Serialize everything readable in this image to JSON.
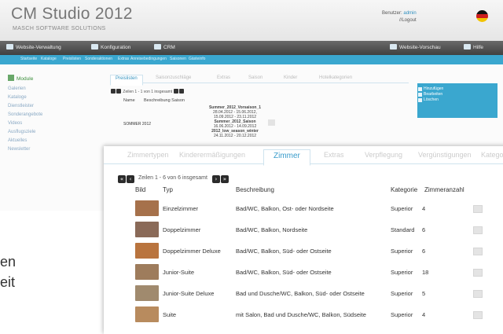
{
  "app": {
    "title": "CM Studio 2012",
    "subtitle": "MASCH SOFTWARE SOLUTIONS",
    "user_label": "Benutzer:",
    "user_name": "admin",
    "logout": "//Logout",
    "flag_colors": [
      "#111111",
      "#cc1e1e",
      "#f2c300"
    ]
  },
  "nav": {
    "items": [
      "Website-Verwaltung",
      "Konfiguration",
      "CRM",
      "Website-Vorschau",
      "Hilfe"
    ]
  },
  "subnav": {
    "items": [
      "Startseite",
      "Kataloge",
      "Preislisten",
      "Sonderaktionen",
      "Extras",
      "Anreisebedingungen",
      "Saisonen",
      "Gästeinfo"
    ]
  },
  "sidebar": {
    "heading": "Module",
    "items": [
      "Galerien",
      "Kataloge",
      "Dienstleister",
      "Sonderangebote",
      "Videos",
      "Ausflugsziele",
      "Aktuelles",
      "Newsletter"
    ]
  },
  "main": {
    "tabs": [
      "Preislisten",
      "Saisonzuschläge",
      "Extras",
      "Saison",
      "Kinder",
      "Hotelkategorien"
    ],
    "pager_text": "Zeilen 1 - 1 von 1 insgesamt",
    "col_name": "Name",
    "col_desc": "Beschreibung Saison",
    "row_name": "SOMMER 2012",
    "seasons": [
      {
        "name": "Summer_2012_Vorsaison_1",
        "dates": "28.04.2012 - 15.06.2012,"
      },
      {
        "name": "",
        "dates": "15.09.2012 - 23.11.2012"
      },
      {
        "name": "Summer_2012_Saison",
        "dates": "16.06.2012 - 14.09.2012"
      },
      {
        "name": "2012_low_season_winter",
        "dates": "24.11.2012 - 20.12.2012"
      }
    ]
  },
  "right_panel": {
    "items": [
      "Hinzufügen",
      "Bearbeiten",
      "Löschen"
    ]
  },
  "background_text": [
    "en",
    "eit"
  ],
  "fg": {
    "tabs": [
      "Zimmertypen",
      "Kinderermäßigungen",
      "Zimmer",
      "Extras",
      "Verpflegung",
      "Vergünstigungen",
      "Kategorien"
    ],
    "pager": {
      "prev_first": "«",
      "prev": "‹",
      "text": "Zeilen 1 - 6 von 6 insgesamt",
      "next": "›",
      "last": "»"
    },
    "columns": {
      "bild": "Bild",
      "typ": "Typ",
      "desc": "Beschreibung",
      "kat": "Kategorie",
      "anz": "Zimmeranzahl"
    },
    "rows": [
      {
        "typ": "Einzelzimmer",
        "desc": "Bad/WC, Balkon, Ost- oder Nordseite",
        "kat": "Superior",
        "anz": "4",
        "thumb_color": "#a6714b"
      },
      {
        "typ": "Doppelzimmer",
        "desc": "Bad/WC, Balkon, Nordseite",
        "kat": "Standard",
        "anz": "6",
        "thumb_color": "#8a6a58"
      },
      {
        "typ": "Doppelzimmer Deluxe",
        "desc": "Bad/WC, Balkon, Süd- oder Ostseite",
        "kat": "Superior",
        "anz": "6",
        "thumb_color": "#b9743e"
      },
      {
        "typ": "Junior-Suite",
        "desc": "Bad/WC, Balkon, Süd- oder Ostseite",
        "kat": "Superior",
        "anz": "18",
        "thumb_color": "#9e7c5c"
      },
      {
        "typ": "Junior-Suite Deluxe",
        "desc": "Bad und Dusche/WC, Balkon, Süd- oder Ostseite",
        "kat": "Superior",
        "anz": "5",
        "thumb_color": "#a08a6e"
      },
      {
        "typ": "Suite",
        "desc": "mit Salon, Bad und Dusche/WC, Balkon, Südseite",
        "kat": "Superior",
        "anz": "4",
        "thumb_color": "#b88b5e"
      }
    ]
  }
}
